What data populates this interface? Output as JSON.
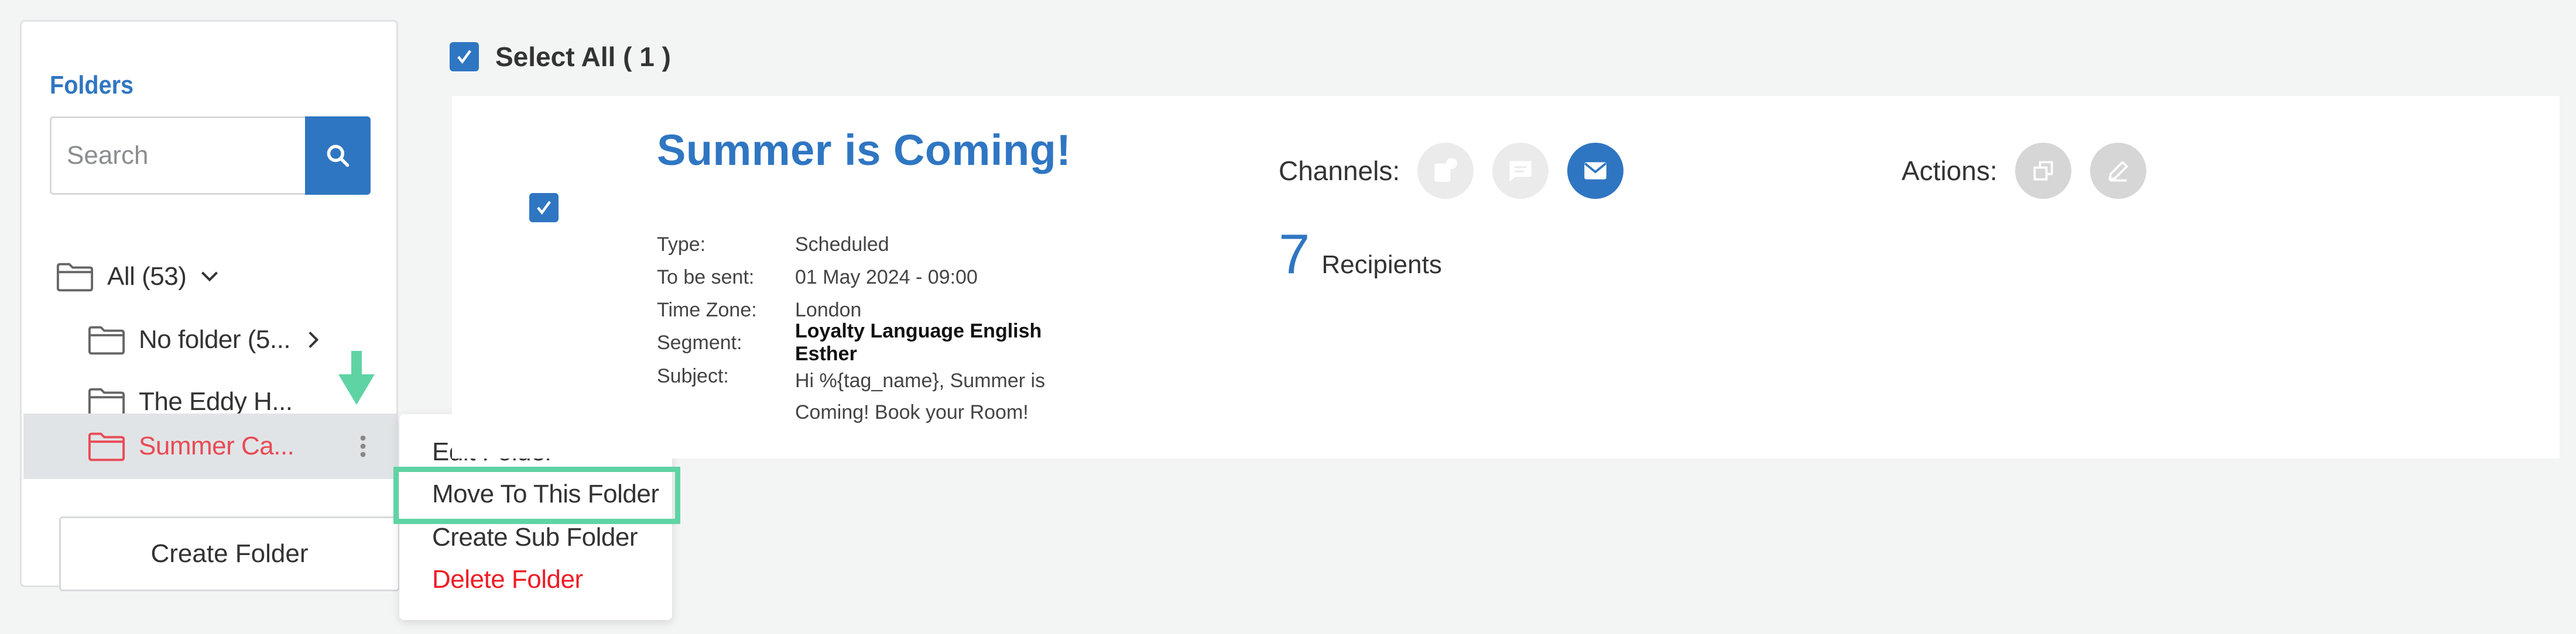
{
  "sidebar": {
    "title": "Folders",
    "search": {
      "placeholder": "Search",
      "value": ""
    },
    "folders": {
      "all": "All (53)",
      "no_folder": "No folder (5...",
      "eddy": "The Eddy H...",
      "summer": "Summer Ca..."
    },
    "create_folder_label": "Create Folder"
  },
  "context_menu": {
    "items": [
      "Edit Folder",
      "Move To This Folder",
      "Create Sub Folder",
      "Delete Folder"
    ]
  },
  "main": {
    "select_all_label": "Select All ( 1 )",
    "campaign": {
      "title": "Summer is Coming!",
      "details": [
        {
          "key": "Type:",
          "value": "Scheduled"
        },
        {
          "key": "To be sent:",
          "value": "01 May 2024 - 09:00"
        },
        {
          "key": "Time Zone:",
          "value": "London"
        },
        {
          "key": "Segment:",
          "value": "Loyalty Language English Esther"
        },
        {
          "key": "Subject:",
          "value": "Hi %{tag_name}, Summer is Coming! Book your Room!"
        }
      ],
      "channels_label": "Channels:",
      "recipients_count": "7",
      "recipients_label": "Recipients",
      "actions_label": "Actions:"
    }
  },
  "colors": {
    "accent": "#2f76c2",
    "highlight": "#5fd3a4",
    "danger": "#ee1c25",
    "selected_folder": "#e84b55"
  }
}
